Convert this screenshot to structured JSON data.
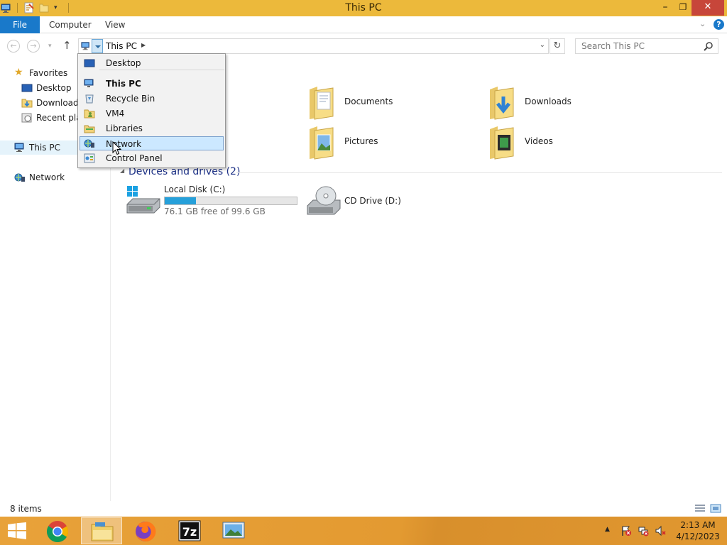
{
  "window": {
    "title": "This PC"
  },
  "ribbon": {
    "tabs": [
      "File",
      "Computer",
      "View"
    ]
  },
  "address": {
    "crumb": "This PC"
  },
  "search": {
    "placeholder": "Search This PC"
  },
  "nav_pane": {
    "favorites": "Favorites",
    "desktop": "Desktop",
    "downloads": "Downloads",
    "recent": "Recent plac",
    "this_pc": "This PC",
    "network": "Network"
  },
  "content": {
    "folders": [
      "Documents",
      "Downloads",
      "Pictures",
      "Videos"
    ],
    "devices_header": "Devices and drives (2)",
    "local_disk": {
      "name": "Local Disk (C:)",
      "free": "76.1 GB free of 99.6 GB",
      "used_fraction": 0.236
    },
    "cd_drive": {
      "name": "CD Drive (D:)"
    }
  },
  "dropdown": {
    "items": [
      "Desktop",
      "This PC",
      "Recycle Bin",
      "VM4",
      "Libraries",
      "Network",
      "Control Panel"
    ],
    "highlighted": "Network"
  },
  "status": {
    "count": "8 items"
  },
  "taskbar": {
    "time": "2:13 AM",
    "date": "4/12/2023"
  },
  "colors": {
    "title_bar": "#ecb93b",
    "accent": "#1979ca",
    "taskbar": "#e39a31",
    "drive_bar": "#26a0da"
  }
}
